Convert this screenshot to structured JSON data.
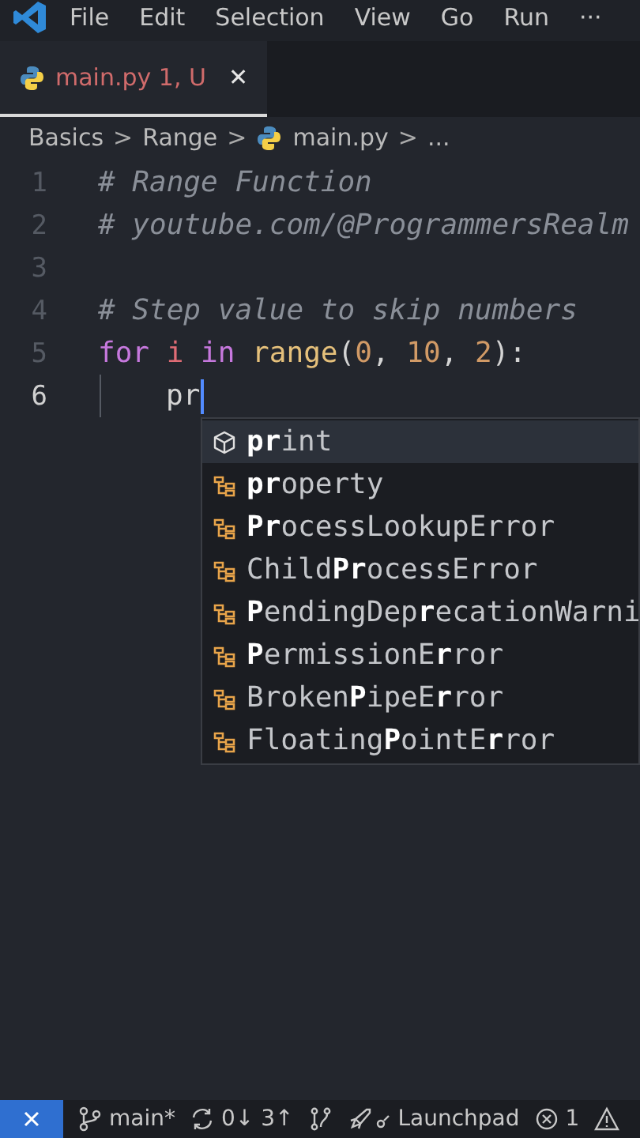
{
  "menu_bar": {
    "items": [
      "File",
      "Edit",
      "Selection",
      "View",
      "Go",
      "Run",
      "···"
    ]
  },
  "tabs": [
    {
      "label": "main.py",
      "decoration": "1, U",
      "selected": true,
      "close": "✕"
    }
  ],
  "breadcrumbs": {
    "items": [
      {
        "label": "Basics",
        "kind": "folder"
      },
      {
        "label": "Range",
        "kind": "folder"
      },
      {
        "label": "main.py",
        "kind": "file"
      },
      {
        "label": "...",
        "kind": "more"
      }
    ],
    "separator": ">"
  },
  "editor": {
    "lines": [
      {
        "number": "1",
        "current": false,
        "tokens": [
          {
            "text": "# Range Function",
            "kind": "comment"
          }
        ]
      },
      {
        "number": "2",
        "current": false,
        "tokens": [
          {
            "text": "# youtube.com/@ProgrammersRealm",
            "kind": "comment"
          }
        ]
      },
      {
        "number": "3",
        "current": false
      },
      {
        "number": "4",
        "current": false,
        "tokens": [
          {
            "text": "# Step value to skip numbers",
            "kind": "comment"
          }
        ]
      },
      {
        "number": "5",
        "current": false,
        "tokens": [
          {
            "text": "for",
            "kind": "keyword"
          },
          {
            "text": " i",
            "kind": "variable"
          },
          {
            "text": " in",
            "kind": "keyword"
          },
          {
            "text": " range",
            "kind": "function"
          },
          {
            "text": "(",
            "kind": "plain"
          },
          {
            "text": "0",
            "kind": "number"
          },
          {
            "text": ", ",
            "kind": "plain"
          },
          {
            "text": "10",
            "kind": "number"
          },
          {
            "text": ", ",
            "kind": "plain"
          },
          {
            "text": "2",
            "kind": "number"
          },
          {
            "text": "):",
            "kind": "plain"
          }
        ]
      },
      {
        "number": "6",
        "current": true,
        "indented": true,
        "tokens": [
          {
            "text": "pr",
            "kind": "plain"
          }
        ]
      }
    ]
  },
  "suggestions": [
    {
      "label": "**pr**int",
      "kind": "method",
      "selected": true
    },
    {
      "label": "**pr**operty",
      "kind": "class",
      "selected": false
    },
    {
      "label": "**Pr**ocessLookupError",
      "kind": "class",
      "selected": false
    },
    {
      "label": "Child**Pr**ocessError",
      "kind": "class",
      "selected": false
    },
    {
      "label": "**P**endingDep**r**ecationWarni",
      "kind": "class",
      "selected": false
    },
    {
      "label": "**P**ermissionE**r**ror",
      "kind": "class",
      "selected": false
    },
    {
      "label": "Broken**P**ipeE**r**ror",
      "kind": "class",
      "selected": false
    },
    {
      "label": "Floating**P**ointE**r**ror",
      "kind": "class",
      "selected": false
    }
  ],
  "status_bar": {
    "items": [
      {
        "kind": "remote"
      },
      {
        "kind": "branch",
        "text": "main*"
      },
      {
        "kind": "sync",
        "text": "0↓ 3↑"
      },
      {
        "kind": "graph"
      },
      {
        "kind": "launchpad",
        "text": "Launchpad"
      },
      {
        "kind": "errors",
        "text": "1"
      },
      {
        "kind": "warnings"
      }
    ]
  }
}
